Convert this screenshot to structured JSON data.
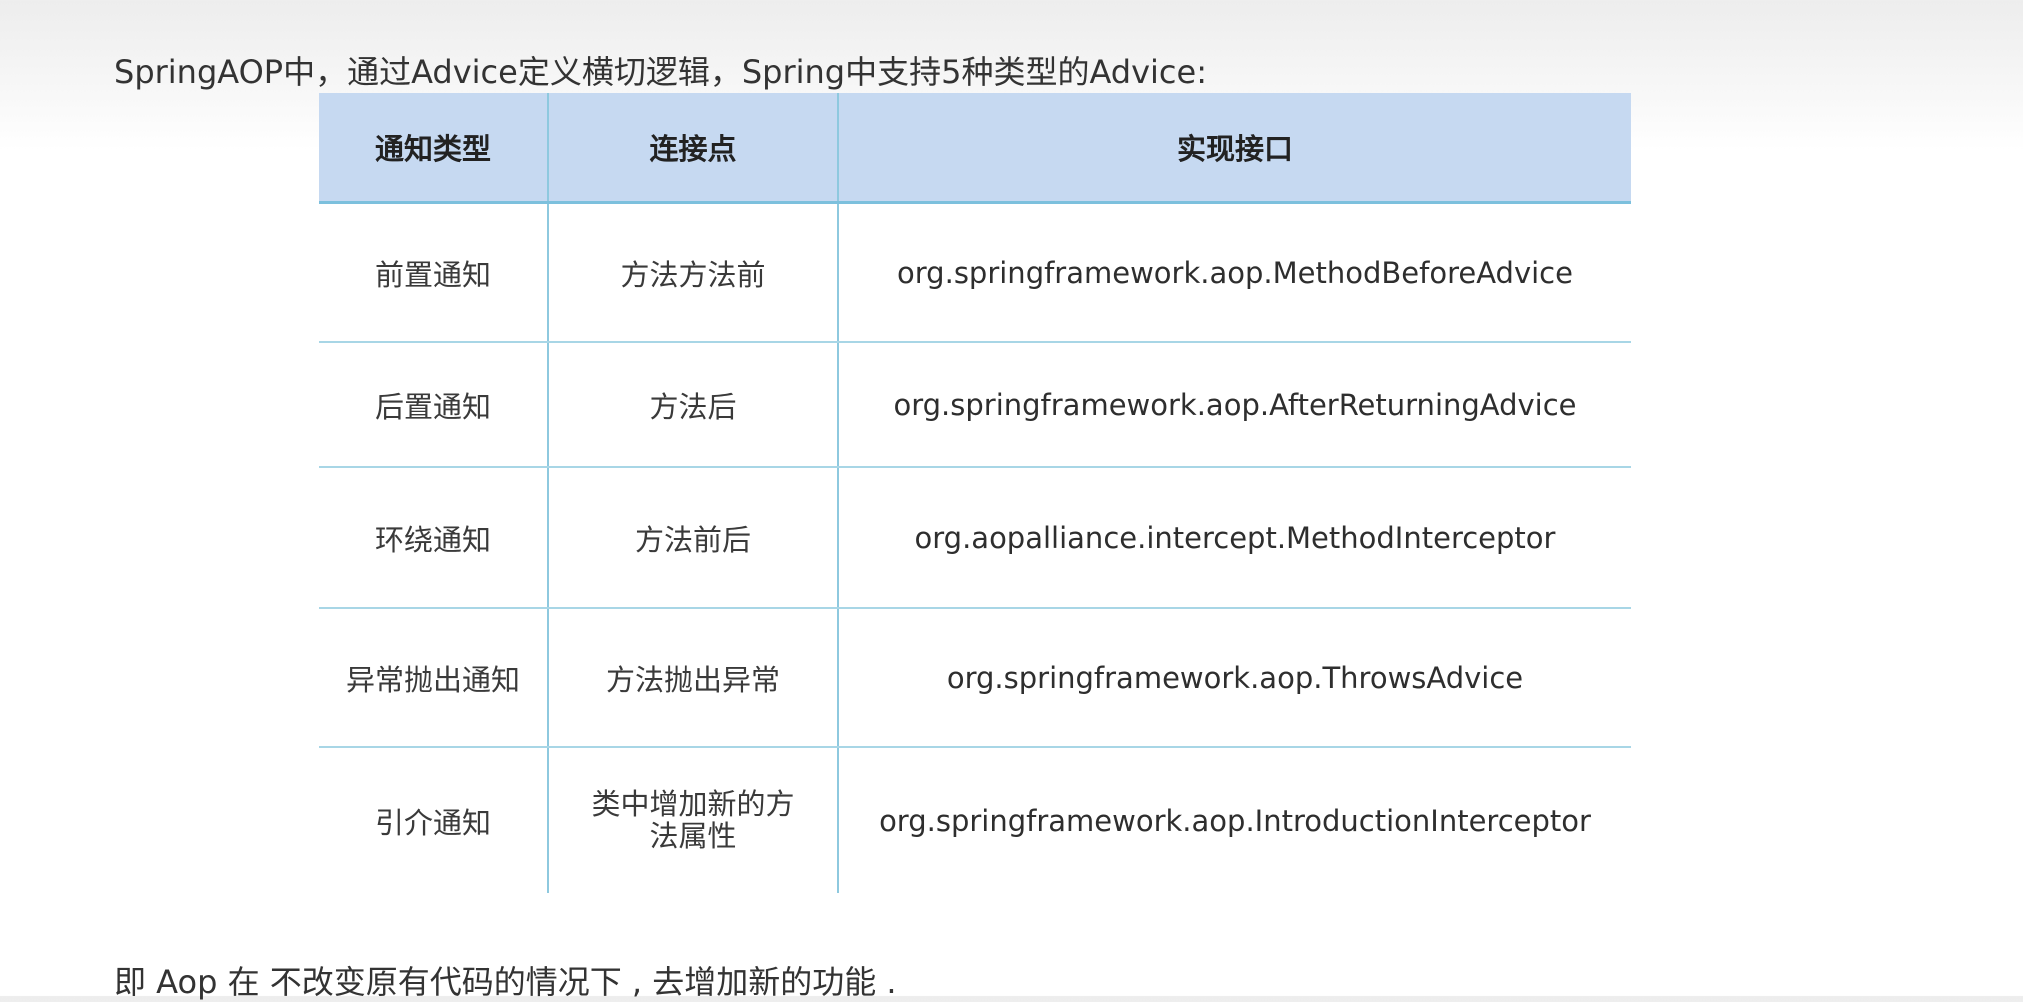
{
  "intro": "SpringAOP中，通过Advice定义横切逻辑，Spring中支持5种类型的Advice:",
  "table": {
    "headers": [
      "通知类型",
      "连接点",
      "实现接口"
    ],
    "rows": [
      {
        "type": "前置通知",
        "joinpoint": "方法方法前",
        "interface": "org.springframework.aop.MethodBeforeAdvice"
      },
      {
        "type": "后置通知",
        "joinpoint": "方法后",
        "interface": "org.springframework.aop.AfterReturningAdvice"
      },
      {
        "type": "环绕通知",
        "joinpoint": "方法前后",
        "interface": "org.aopalliance.intercept.MethodInterceptor"
      },
      {
        "type": "异常抛出通知",
        "joinpoint": "方法抛出异常",
        "interface": "org.springframework.aop.ThrowsAdvice"
      },
      {
        "type": "引介通知",
        "joinpoint": "类中增加新的方法属性",
        "interface": "org.springframework.aop.IntroductionInterceptor"
      }
    ]
  },
  "outro": "即 Aop 在 不改变原有代码的情况下 , 去增加新的功能 ."
}
